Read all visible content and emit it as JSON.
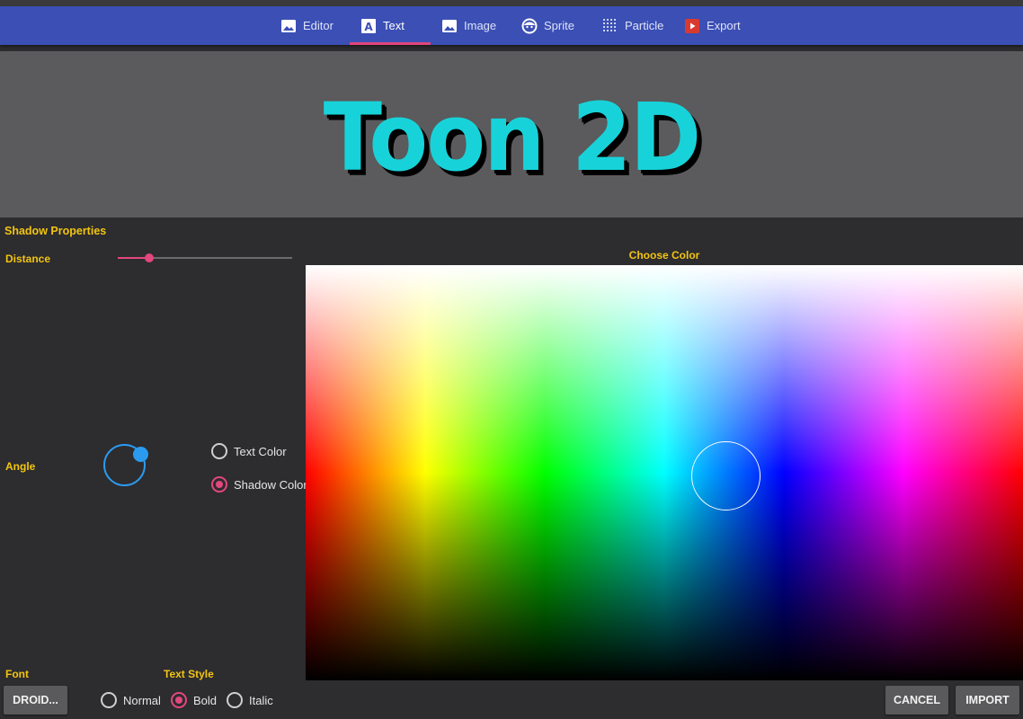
{
  "nav": {
    "tabs": [
      {
        "label": "Editor",
        "icon": "image-icon"
      },
      {
        "label": "Text",
        "icon": "text-box-icon",
        "active": true
      },
      {
        "label": "Image",
        "icon": "image-icon"
      },
      {
        "label": "Sprite",
        "icon": "face-icon"
      },
      {
        "label": "Particle",
        "icon": "dots-grid-icon"
      },
      {
        "label": "Export",
        "icon": "video-export-icon"
      }
    ],
    "accent_color": "#3b4fb5",
    "active_indicator_color": "#e0457b"
  },
  "preview": {
    "text": "Toon 2D",
    "text_color": "#17d3d9",
    "shadow_color": "#000000"
  },
  "shadow": {
    "title": "Shadow Properties",
    "distance_label": "Distance",
    "distance_value": 0.18,
    "angle_label": "Angle",
    "angle_degrees": 45,
    "color_target_options": [
      {
        "label": "Text Color",
        "selected": false
      },
      {
        "label": "Shadow Color",
        "selected": true
      }
    ]
  },
  "color_picker": {
    "label": "Choose Color",
    "selected_color": "#0fe6d8"
  },
  "font": {
    "label": "Font",
    "button_label": "DROID..."
  },
  "text_style": {
    "label": "Text Style",
    "options": [
      {
        "label": "Normal",
        "selected": false
      },
      {
        "label": "Bold",
        "selected": true
      },
      {
        "label": "Italic",
        "selected": false
      }
    ]
  },
  "actions": {
    "cancel_label": "CANCEL",
    "import_label": "IMPORT"
  },
  "colors": {
    "label_yellow": "#f2c511",
    "accent_pink": "#e2477d",
    "dial_blue": "#2b9bf0"
  }
}
